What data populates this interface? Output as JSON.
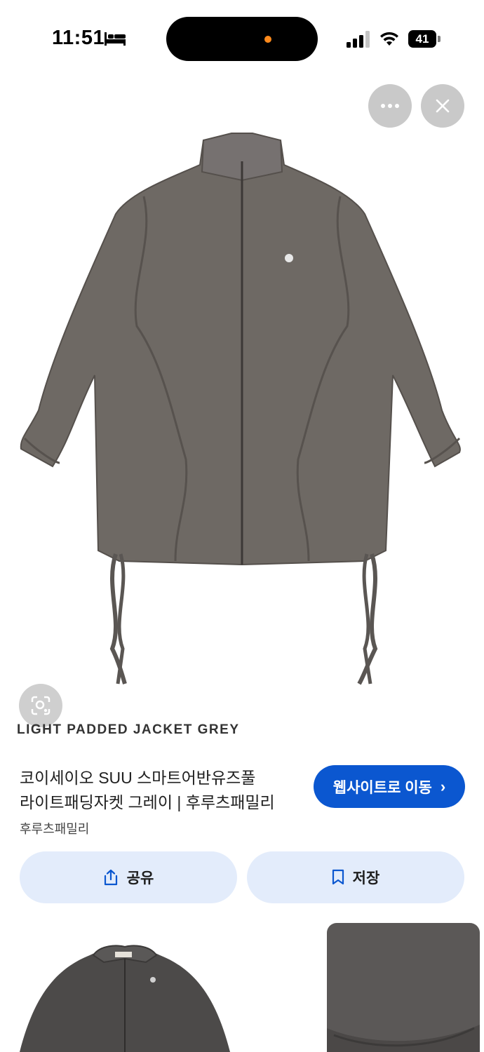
{
  "status_bar": {
    "time": "11:51",
    "battery": "41",
    "icons": [
      "bed-icon",
      "signal-icon",
      "wifi-icon",
      "battery-icon"
    ]
  },
  "top_controls": {
    "more_icon": "more-horizontal-icon",
    "close_icon": "close-icon"
  },
  "image": {
    "caption": "LIGHT PADDED JACKET GREY",
    "lens_icon": "lens-search-icon",
    "jacket_color": "#6e6964"
  },
  "result": {
    "title_lines": [
      "코이세이오 SUU 스마트어반유즈풀",
      "라이트패딩자켓 그레이 | 후루츠패밀리"
    ],
    "source": "후루츠패밀리",
    "visit_label": "웹사이트로 이동",
    "visit_chevron": "›"
  },
  "actions": {
    "share_label": "공유",
    "save_label": "저장"
  },
  "colors": {
    "accent": "#0b57d0",
    "action_bg": "#e3ecfb"
  }
}
